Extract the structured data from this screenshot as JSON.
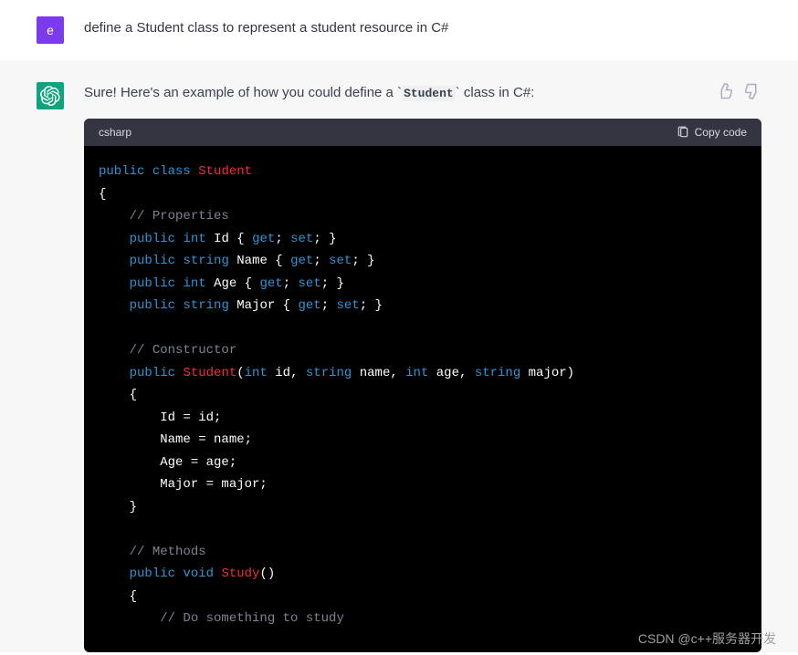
{
  "user": {
    "avatar_letter": "e",
    "message": "define a Student class to represent a student resource in C#"
  },
  "assistant": {
    "text_before": "Sure! Here's an example of how you could define a ",
    "inline_code": "Student",
    "text_after": " class in C#:"
  },
  "code": {
    "language": "csharp",
    "copy_label": "Copy code",
    "tokens": {
      "public": "public",
      "class": "class",
      "student": "Student",
      "brace_open": "{",
      "brace_close": "}",
      "comment_props": "// Properties",
      "int": "int",
      "string": "string",
      "void": "void",
      "id": "Id",
      "name": "Name",
      "age": "Age",
      "major": "Major",
      "get": "get",
      "set": "set",
      "semi": ";",
      "comment_ctor": "// Constructor",
      "param_id": "id",
      "param_name": "name",
      "param_age": "age",
      "param_major": "major",
      "comma": ",",
      "paren_open": "(",
      "paren_close": ")",
      "assign_id": "Id = id;",
      "assign_name": "Name = name;",
      "assign_age": "Age = age;",
      "assign_major": "Major = major;",
      "comment_methods": "// Methods",
      "study": "Study",
      "comment_study": "// Do something to study"
    }
  },
  "watermark": "CSDN @c++服务器开发"
}
